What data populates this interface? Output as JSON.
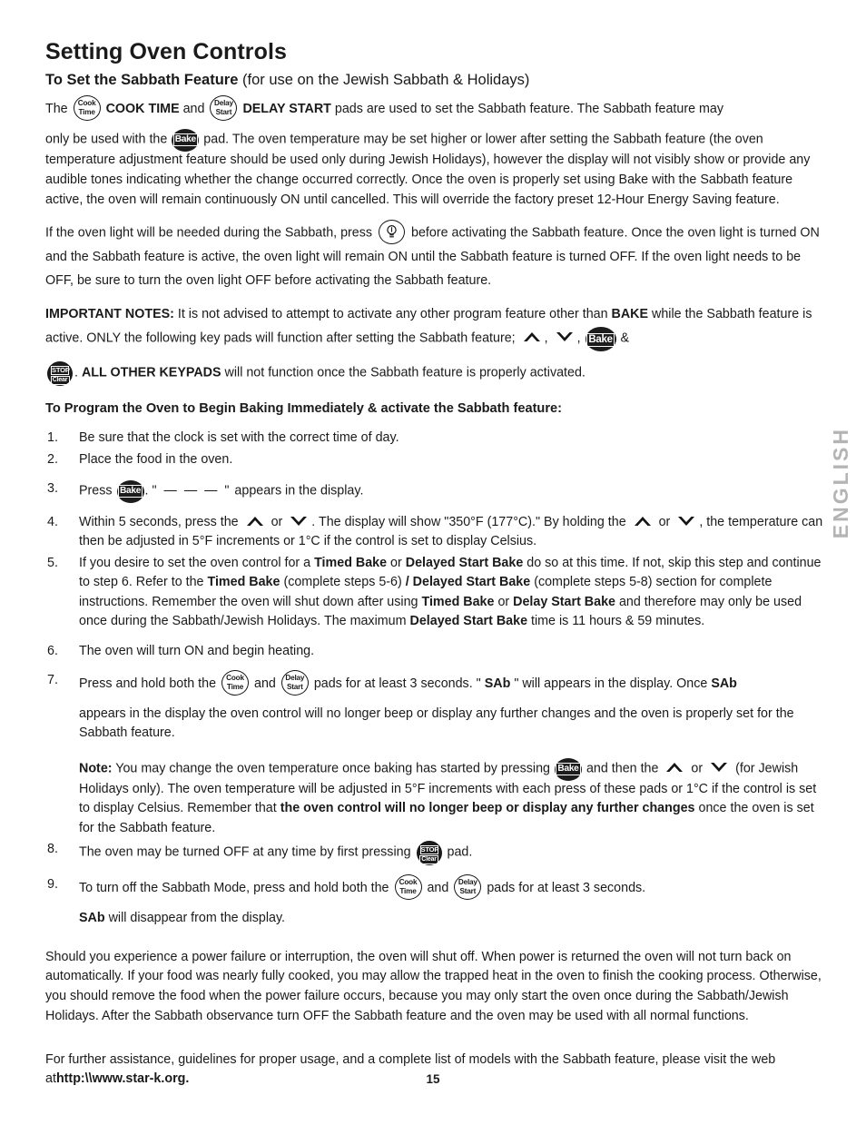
{
  "document": {
    "title": "Setting Oven Controls",
    "subtitle_bold": "To Set the Sabbath Feature",
    "subtitle_light": "(for use on the Jewish Sabbath & Holidays)",
    "page_number": "15",
    "side_tab": "ENGLISH"
  },
  "icons": {
    "cook_time": {
      "line1": "Cook",
      "line2": "Time",
      "name": "cook-time-pad-icon"
    },
    "delay_start": {
      "line1": "Delay",
      "line2": "Start",
      "name": "delay-start-pad-icon"
    },
    "bake": {
      "label": "Bake",
      "name": "bake-pad-icon"
    },
    "stop_clear": {
      "line1": "STOP",
      "line2": "Clear",
      "name": "stop-clear-pad-icon"
    },
    "oven_light": {
      "name": "oven-light-bulb-icon"
    },
    "arrow_up": {
      "name": "chevron-up-icon"
    },
    "arrow_down": {
      "name": "chevron-down-icon"
    }
  },
  "intro": {
    "p1_a": "The",
    "p1_b": "COOK TIME",
    "p1_c": "and",
    "p1_d": "DELAY START",
    "p1_e": "pads are used to set the Sabbath feature. The Sabbath feature may",
    "p2_a": "only be used with the",
    "p2_b": "pad. The oven temperature may be set higher or lower after setting the Sabbath feature (the oven temperature adjustment feature should be used only during Jewish Holidays), however the display will not visibly show or provide any audible tones indicating whether the change occurred correctly. Once the oven is properly set using Bake with the Sabbath feature active, the oven will remain continuously ON until cancelled. This will override the factory preset 12-Hour Energy Saving feature.",
    "p3_a": "If the oven light will be needed during the Sabbath, press",
    "p3_b": "before activating the Sabbath feature. Once the oven light is turned ON and the Sabbath feature is active, the oven light will remain ON until the Sabbath feature is turned OFF. If the oven light needs to be OFF, be sure to turn the oven light OFF before activating the Sabbath feature."
  },
  "important_notes": {
    "label": "IMPORTANT NOTES:",
    "text_a": "It is not advised to attempt to activate any other program feature other than",
    "bake_word": "BAKE",
    "text_b": "while the Sabbath feature is active. ONLY the following key pads will function after setting the Sabbath feature;",
    "comma1": ",",
    "comma2": ",",
    "ampersand": "&",
    "period": ".",
    "text_c_bold": "ALL OTHER KEYPADS",
    "text_c": "will not function once the Sabbath feature is properly activated."
  },
  "program_section": {
    "heading": "To Program the Oven to Begin Baking Immediately & activate the Sabbath feature:",
    "steps": [
      {
        "num": "1.",
        "text": "Be sure that the clock is set with the correct time of day."
      },
      {
        "num": "2.",
        "text": "Place the food in the oven."
      },
      {
        "num": "3.",
        "pre": "Press",
        "dashes": "\" — — —  \"",
        "post": "appears in the display."
      },
      {
        "num": "4.",
        "a": "Within 5 seconds, press the",
        "b": "or",
        "c": ". The display will show \"350°F (177°C).\" By holding the",
        "d": "or",
        "e": ", the temperature can then be adjusted in 5°F increments or 1°C if the control is set to display Celsius."
      },
      {
        "num": "5.",
        "parts": [
          {
            "t": "If you desire to set the oven control for a ",
            "b": false
          },
          {
            "t": "Timed Bake",
            "b": true
          },
          {
            "t": " or ",
            "b": false
          },
          {
            "t": "Delayed Start Bake",
            "b": true
          },
          {
            "t": " do so at this time. If not, skip this step and continue to step 6. Refer to the ",
            "b": false
          },
          {
            "t": "Timed Bake",
            "b": true
          },
          {
            "t": " (complete steps 5-6) ",
            "b": false
          },
          {
            "t": "/ Delayed Start Bake",
            "b": true
          },
          {
            "t": " (complete steps 5-8) section for complete instructions. Remember the oven will shut down after using ",
            "b": false
          },
          {
            "t": "Timed Bake",
            "b": true
          },
          {
            "t": " or ",
            "b": false
          },
          {
            "t": "Delay Start Bake",
            "b": true
          },
          {
            "t": " and therefore may only be used once during the Sabbath/Jewish Holidays. The maximum ",
            "b": false
          },
          {
            "t": "Delayed Start Bake",
            "b": true
          },
          {
            "t": " time is 11 hours & 59 minutes.",
            "b": false
          }
        ]
      },
      {
        "num": "6.",
        "text": "The oven will turn ON and begin heating."
      },
      {
        "num": "7.",
        "a": "Press and hold both the",
        "b": "and",
        "c": "pads for at least 3 seconds. \"",
        "sab1": "SAb",
        "d": "\" will appears in the display. Once",
        "sab2": "SAb",
        "cont": "appears in the display the oven control will no longer beep or display any further changes and the oven is properly set for the Sabbath feature."
      },
      {
        "num": "8.",
        "a": "The oven may be turned OFF at any time by first pressing",
        "b": "pad."
      },
      {
        "num": "9.",
        "a": "To turn off the Sabbath Mode, press and hold both the",
        "b": "and",
        "c": "pads for at least 3 seconds.",
        "sab": "SAb",
        "d": "will disappear from the display."
      }
    ],
    "note": {
      "label": "Note:",
      "a": "You may change the oven temperature once baking has started by pressing",
      "b": "and then the",
      "c": "or",
      "d": "(for Jewish Holidays only). The oven temperature will be adjusted in 5°F increments with each press of these pads or 1°C if the control is set to display Celsius. Remember that",
      "e_bold": "the oven control will no longer beep or display any further changes",
      "f": "once the oven is set for the Sabbath feature."
    }
  },
  "closing": {
    "power_failure": "Should you experience a power failure or interruption, the oven will shut off. When power is returned the oven will not turn back on automatically. If your food was nearly fully cooked, you may allow the trapped heat in the oven to finish the cooking process. Otherwise, you should remove the food when the power failure occurs, because you may only start the oven once during the Sabbath/Jewish Holidays. After the Sabbath observance turn OFF the Sabbath feature and the oven may be used with all normal functions.",
    "assistance_a": "For further assistance, guidelines for proper usage, and a complete list of models with the Sabbath feature, please visit the web at",
    "assistance_url": "http:\\\\www.star-k.org."
  }
}
